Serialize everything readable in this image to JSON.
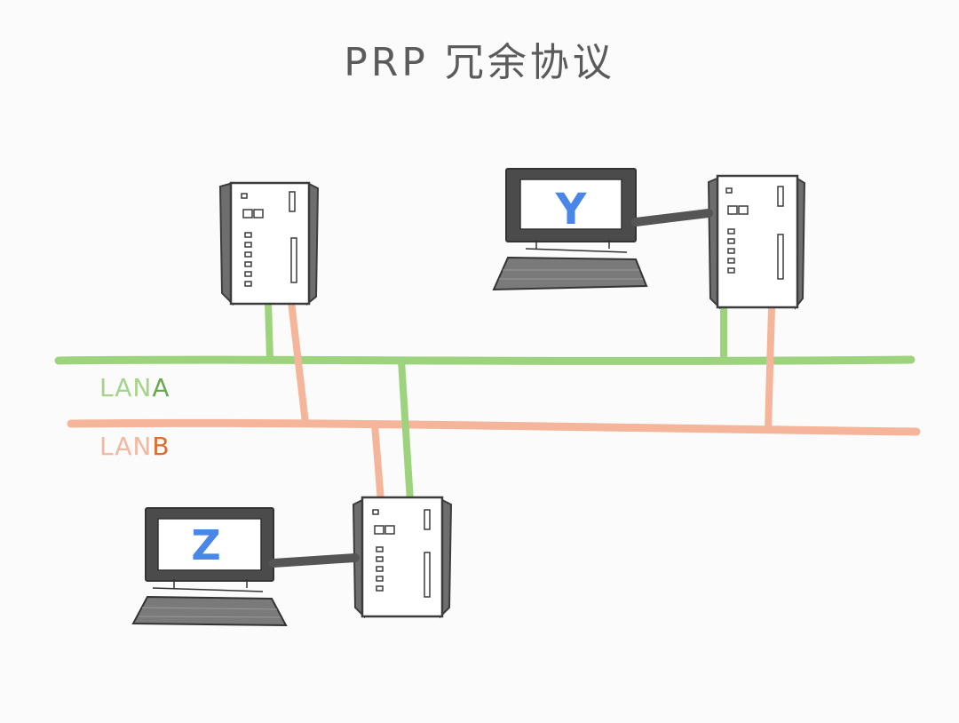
{
  "title": "PRP 冗余协议",
  "networks": {
    "lan_a": {
      "prefix": "LAN",
      "suffix": "A",
      "color": "#9ed37e",
      "accent": "#6aa84f"
    },
    "lan_b": {
      "prefix": "LAN",
      "suffix": "B",
      "color": "#f4b59a",
      "accent": "#e06b2b"
    }
  },
  "hosts": {
    "y": {
      "label": "Y",
      "color": "#4a86e8"
    },
    "z": {
      "label": "Z",
      "color": "#4a86e8"
    }
  },
  "devices": [
    "redbox-top-left",
    "redbox-top-right",
    "redbox-bottom"
  ],
  "colors": {
    "device_outline": "#3c3c3c",
    "device_fill": "#ffffff",
    "device_side": "#6e6e6e",
    "monitor": "#4b4b4b",
    "cable": "#555555"
  }
}
